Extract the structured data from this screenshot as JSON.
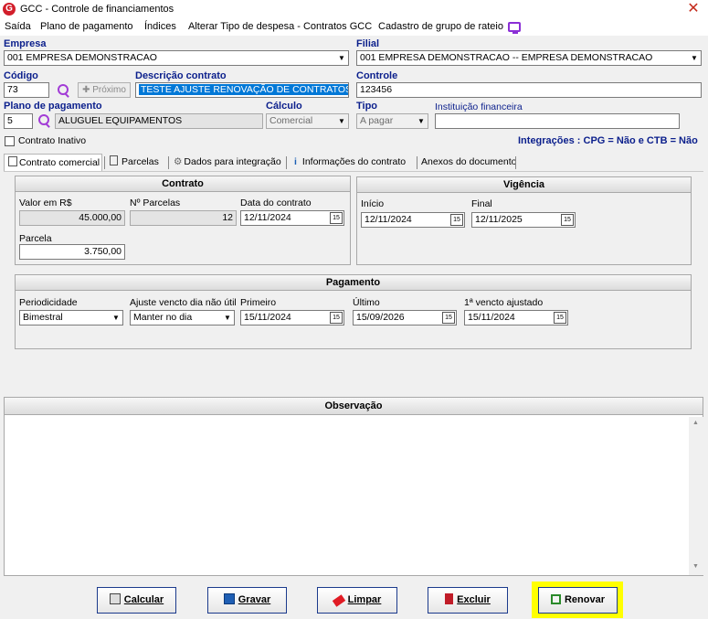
{
  "window": {
    "title": "GCC - Controle de financiamentos",
    "close": "✕"
  },
  "menu": {
    "items": [
      "Saída",
      "Plano de pagamento",
      "Índices",
      "Alterar Tipo de despesa - Contratos GCC",
      "Cadastro de grupo de rateio"
    ]
  },
  "form": {
    "empresa_label": "Empresa",
    "empresa_value": "001 EMPRESA DEMONSTRACAO",
    "filial_label": "Filial",
    "filial_value": "001 EMPRESA DEMONSTRACAO -- EMPRESA DEMONSTRACAO",
    "codigo_label": "Código",
    "codigo_value": "73",
    "proximo_label": "Próximo",
    "descricao_label": "Descrição contrato",
    "descricao_value": "TESTE AJUSTE RENOVAÇÃO DE CONTRATOS",
    "controle_label": "Controle",
    "controle_value": "123456",
    "plano_label": "Plano de pagamento",
    "plano_code": "5",
    "plano_value": "ALUGUEL EQUIPAMENTOS",
    "calculo_label": "Cálculo",
    "calculo_value": "Comercial",
    "tipo_label": "Tipo",
    "tipo_value": "A pagar",
    "instituicao_label": "Instituição financeira",
    "instituicao_value": "",
    "inativo_label": "Contrato Inativo",
    "integracoes_text": "Integrações : CPG = Não e CTB = Não"
  },
  "tabs": [
    "Contrato comercial",
    "Parcelas",
    "Dados para integração",
    "Informações do contrato",
    "Anexos do documento"
  ],
  "contrato": {
    "header": "Contrato",
    "valor_label": "Valor em R$",
    "valor_value": "45.000,00",
    "nparcelas_label": "Nº Parcelas",
    "nparcelas_value": "12",
    "data_label": "Data do contrato",
    "data_value": "12/11/2024",
    "parcela_label": "Parcela",
    "parcela_value": "3.750,00"
  },
  "vigencia": {
    "header": "Vigência",
    "inicio_label": "Início",
    "inicio_value": "12/11/2024",
    "final_label": "Final",
    "final_value": "12/11/2025"
  },
  "pagamento": {
    "header": "Pagamento",
    "periodicidade_label": "Periodicidade",
    "periodicidade_value": "Bimestral",
    "ajuste_label": "Ajuste vencto dia não útil",
    "ajuste_value": "Manter no dia",
    "primeiro_label": "Primeiro",
    "primeiro_value": "15/11/2024",
    "ultimo_label": "Último",
    "ultimo_value": "15/09/2026",
    "vencto_label": "1ª vencto ajustado",
    "vencto_value": "15/11/2024"
  },
  "observacao": {
    "header": "Observação",
    "text": ""
  },
  "buttons": {
    "calcular": "Calcular",
    "gravar": "Gravar",
    "limpar": "Limpar",
    "excluir": "Excluir",
    "renovar": "Renovar"
  },
  "colors": {
    "accent": "#0b1f8c",
    "highlight": "#ffff00",
    "selection": "#0078d7"
  },
  "icons": [
    "app-logo-icon",
    "close-icon",
    "display-icon",
    "search-icon",
    "calendar-icon",
    "calculator-icon",
    "floppy-icon",
    "eraser-icon",
    "trash-icon",
    "copy-icon"
  ]
}
